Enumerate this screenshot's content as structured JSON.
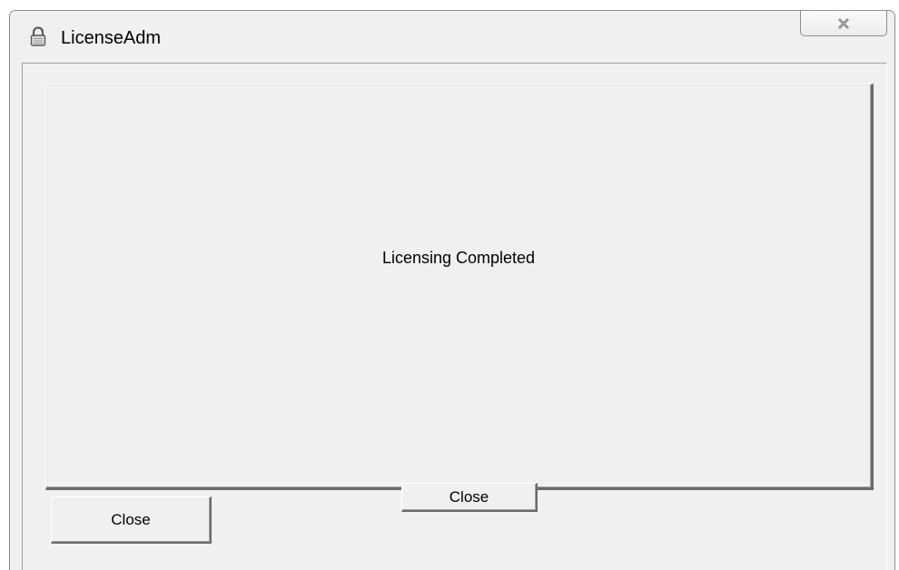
{
  "window": {
    "title": "LicenseAdm",
    "title_icon": "lock-icon",
    "close_icon": "close-icon"
  },
  "panel": {
    "message": "Licensing Completed",
    "close_button_label": "Close"
  },
  "footer": {
    "close_button_label": "Close"
  }
}
